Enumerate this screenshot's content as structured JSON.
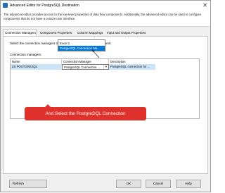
{
  "window": {
    "title": "Advanced Editor for PostgreSQL Destination",
    "description": "The advanced editor provides access to the low-level properties of data flow components. Additionally, the advanced editor can be used to configure components that do not have a custom user interface."
  },
  "tabs": [
    {
      "label": "Connection Managers",
      "active": true
    },
    {
      "label": "Component Properties",
      "active": false
    },
    {
      "label": "Column Mappings",
      "active": false
    },
    {
      "label": "Input and Output Properties",
      "active": false
    }
  ],
  "panel": {
    "instruction": "Select the connection managers to be used for the data flow component.",
    "group_label": "Connection managers:"
  },
  "grid": {
    "columns": [
      "Name",
      "Connection Manager",
      "Description"
    ],
    "row": {
      "name": "ZS POSTGRESQL",
      "connection_manager": "PostgreSQL Connection ...",
      "description": "PostgreSQL connection for ..."
    }
  },
  "dropdown": {
    "options": [
      "Excel 1",
      "PostgreSQL Connection Ma..."
    ],
    "highlighted_index": 1
  },
  "callout": {
    "text": "And Select the PostgreSQL Connection",
    "color": "#e0322c"
  },
  "buttons": {
    "refresh": "Refresh",
    "ok": "OK",
    "cancel": "Cancel",
    "help": "Help"
  }
}
